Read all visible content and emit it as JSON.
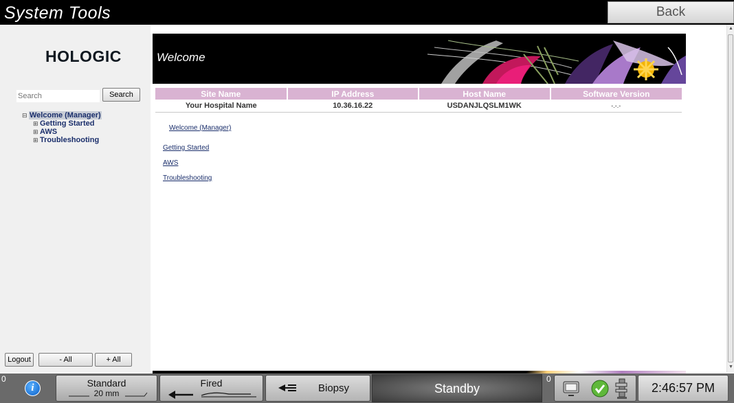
{
  "app": {
    "title": "System Tools",
    "back_label": "Back"
  },
  "sidebar": {
    "logo": "HOLOGIC",
    "search_placeholder": "Search",
    "search_button": "Search",
    "tree": {
      "root": "Welcome (Manager)",
      "children": [
        "Getting Started",
        "AWS",
        "Troubleshooting"
      ]
    },
    "buttons": {
      "logout": "Logout",
      "collapse_all": "- All",
      "expand_all": "+ All"
    }
  },
  "banner": {
    "title": "Welcome"
  },
  "site_table": {
    "headers": [
      "Site Name",
      "IP Address",
      "Host Name",
      "Software Version"
    ],
    "rows": [
      [
        "Your Hospital Name",
        "10.36.16.22",
        "USDANJLQSLM1WK",
        "-.-.-"
      ]
    ]
  },
  "links": {
    "welcome": "Welcome (Manager)",
    "getting_started": "Getting Started",
    "aws": "AWS",
    "troubleshooting": "Troubleshooting"
  },
  "status_bar": {
    "left_count": "0",
    "compression": {
      "mode": "Standard",
      "thickness": "20 mm"
    },
    "exposure": "Fired",
    "biopsy": "Biopsy",
    "state": "Standby",
    "right_count": "0",
    "time": "2:46:57 PM"
  }
}
